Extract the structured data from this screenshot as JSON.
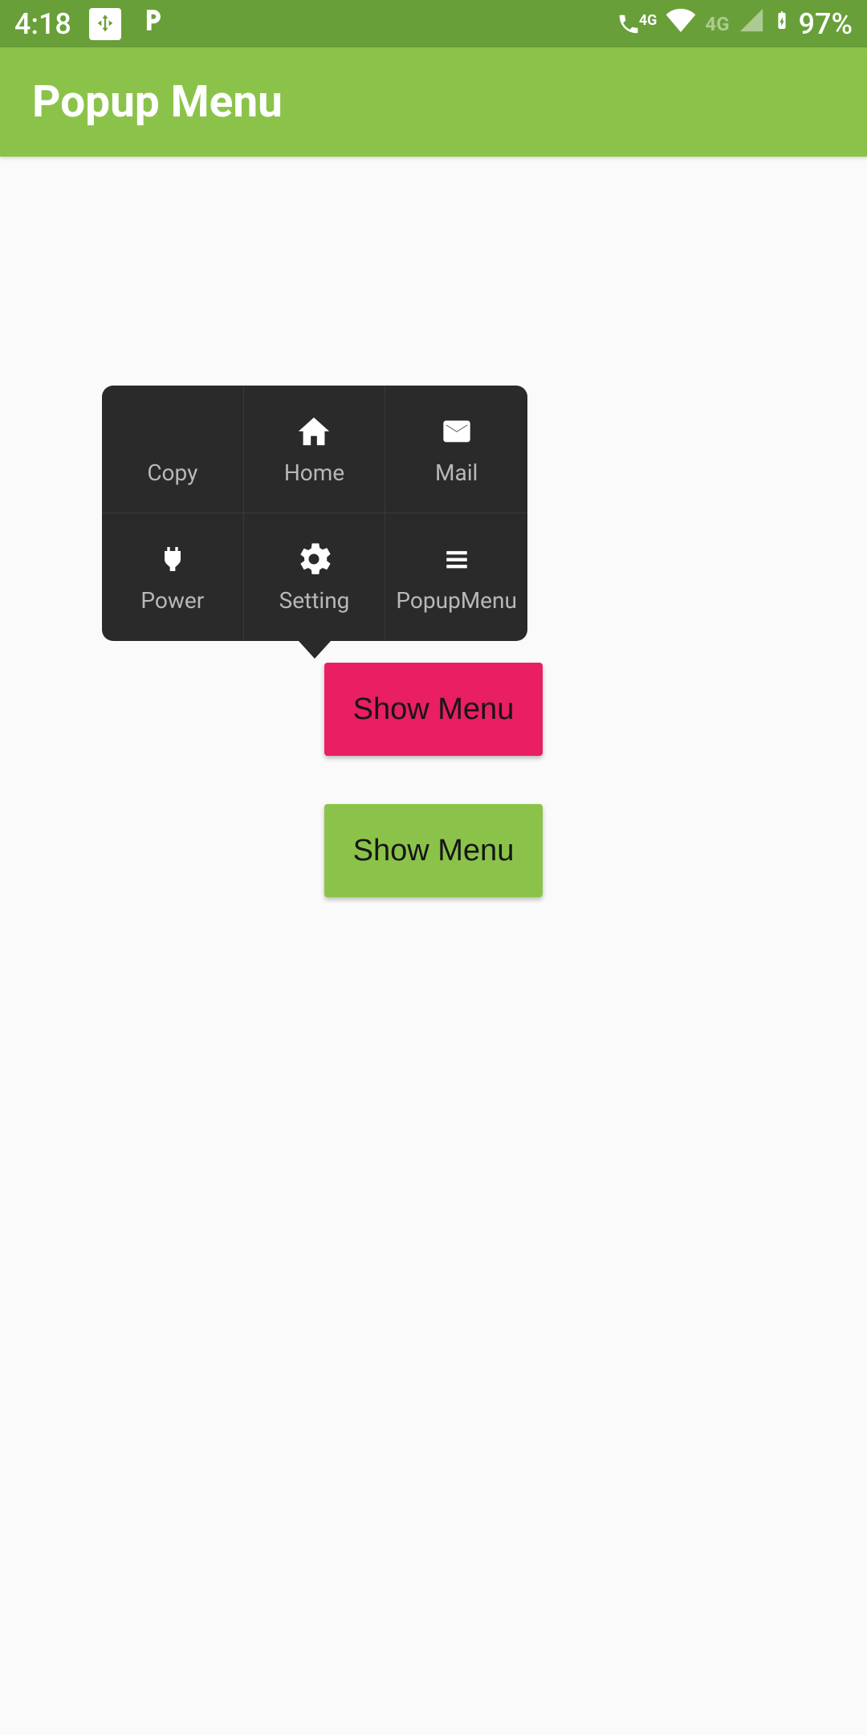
{
  "status": {
    "time": "4:18",
    "battery_text": "97%",
    "net_label": "4G",
    "net_label_dim": "4G"
  },
  "app": {
    "title": "Popup Menu"
  },
  "popup": {
    "items": [
      {
        "label": "Copy",
        "icon": ""
      },
      {
        "label": "Home",
        "icon": "home"
      },
      {
        "label": "Mail",
        "icon": "mail"
      },
      {
        "label": "Power",
        "icon": "power"
      },
      {
        "label": "Setting",
        "icon": "gear"
      },
      {
        "label": "PopupMenu",
        "icon": "hamburger"
      }
    ]
  },
  "buttons": {
    "primary": "Show Menu",
    "secondary": "Show Menu"
  }
}
